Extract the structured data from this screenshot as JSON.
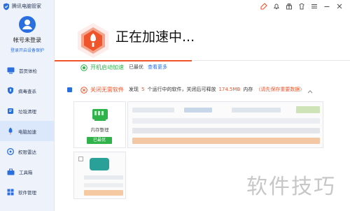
{
  "app": {
    "title": "腾讯电脑管家"
  },
  "account": {
    "name": "帐号未登录",
    "login_link": "登录开启设备保护"
  },
  "nav": {
    "items": [
      {
        "label": "首页体检",
        "icon": "monitor-icon"
      },
      {
        "label": "病毒查杀",
        "icon": "shield-icon"
      },
      {
        "label": "垃圾清理",
        "icon": "broom-icon"
      },
      {
        "label": "电脑加速",
        "icon": "rocket-icon",
        "active": true
      },
      {
        "label": "权限雷达",
        "icon": "radar-icon"
      },
      {
        "label": "工具箱",
        "icon": "toolbox-icon"
      },
      {
        "label": "软件管理",
        "icon": "apps-icon"
      }
    ]
  },
  "titlebar": {
    "icons": [
      "broom-icon",
      "bell-icon",
      "gift-icon",
      "skin-icon",
      "menu-icon",
      "minimize-icon",
      "close-icon"
    ]
  },
  "header": {
    "title": "正在加速中..."
  },
  "boot_row": {
    "label": "开机启动加速",
    "status": "已最优",
    "link": "查看更多"
  },
  "close_row": {
    "label": "关闭无需软件",
    "t1": "发现",
    "count": "5",
    "t2": "个运行中的软件，关闭后可释放",
    "amount": "174.5MB",
    "t3": "内存",
    "warn": "（请先保存重要数据）"
  },
  "memory_card": {
    "label": "内存整理",
    "status": "已最优"
  },
  "watermark": "软件技巧",
  "colors": {
    "accent": "#f0542a",
    "brand": "#2a6fe0",
    "ok": "#2fb34a",
    "sidebar": "#eef3fb"
  }
}
